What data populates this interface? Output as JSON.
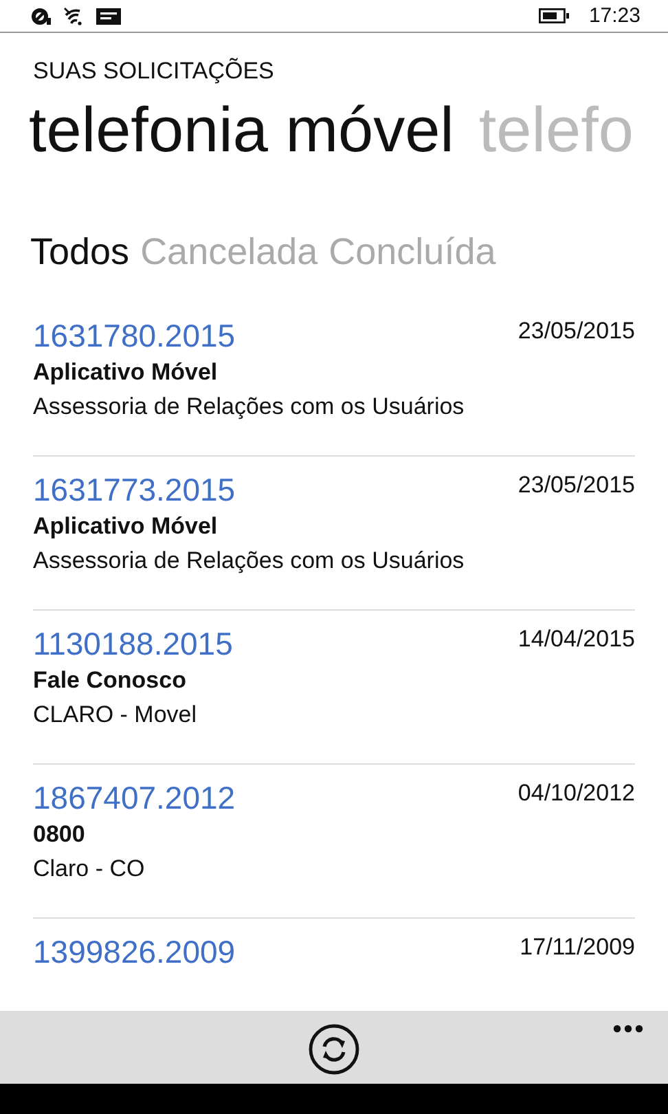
{
  "status_bar": {
    "time": "17:23"
  },
  "header": "SUAS SOLICITAÇÕES",
  "pivots": [
    {
      "label": "telefonia móvel",
      "selected": true
    },
    {
      "label": "telefo",
      "selected": false
    }
  ],
  "filters": [
    {
      "label": "Todos",
      "selected": true
    },
    {
      "label": "Cancelada",
      "selected": false
    },
    {
      "label": "Concluída",
      "selected": false
    }
  ],
  "requests": [
    {
      "number": "1631780.2015",
      "date": "23/05/2015",
      "channel": "Aplicativo Móvel",
      "department": "Assessoria de Relações com os Usuários"
    },
    {
      "number": "1631773.2015",
      "date": "23/05/2015",
      "channel": "Aplicativo Móvel",
      "department": "Assessoria de Relações com os Usuários"
    },
    {
      "number": "1130188.2015",
      "date": "14/04/2015",
      "channel": "Fale Conosco",
      "department": "CLARO - Movel"
    },
    {
      "number": "1867407.2012",
      "date": "04/10/2012",
      "channel": "0800",
      "department": "Claro - CO"
    },
    {
      "number": "1399826.2009",
      "date": "17/11/2009"
    }
  ]
}
